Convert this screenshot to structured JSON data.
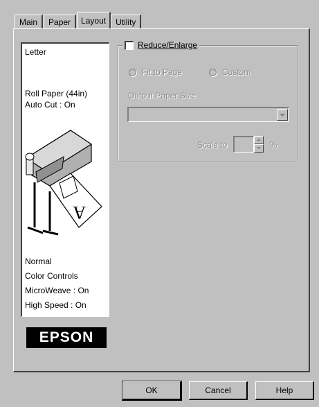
{
  "tabs": [
    "Main",
    "Paper",
    "Layout",
    "Utility"
  ],
  "preview": {
    "paper_size": "Letter",
    "paper_source": "Roll Paper (44in)",
    "auto_cut": "Auto Cut : On",
    "mode": "Normal",
    "color": "Color Controls",
    "microweave": "MicroWeave : On",
    "high_speed": "High Speed : On",
    "logo": "EPSON"
  },
  "reduce_enlarge": {
    "checkbox_label": "Reduce/Enlarge",
    "checked": false,
    "fit_to_page": "Fit to Page",
    "custom": "Custom",
    "output_paper_size_label": "Output Paper Size",
    "output_paper_size_value": "",
    "scale_to_label": "Scale to",
    "scale_value": "",
    "percent": "%"
  },
  "buttons": {
    "ok": "OK",
    "cancel": "Cancel",
    "help": "Help"
  },
  "colors": {
    "face": "#c0c0c0",
    "disabled_text": "#8a8a8a"
  }
}
